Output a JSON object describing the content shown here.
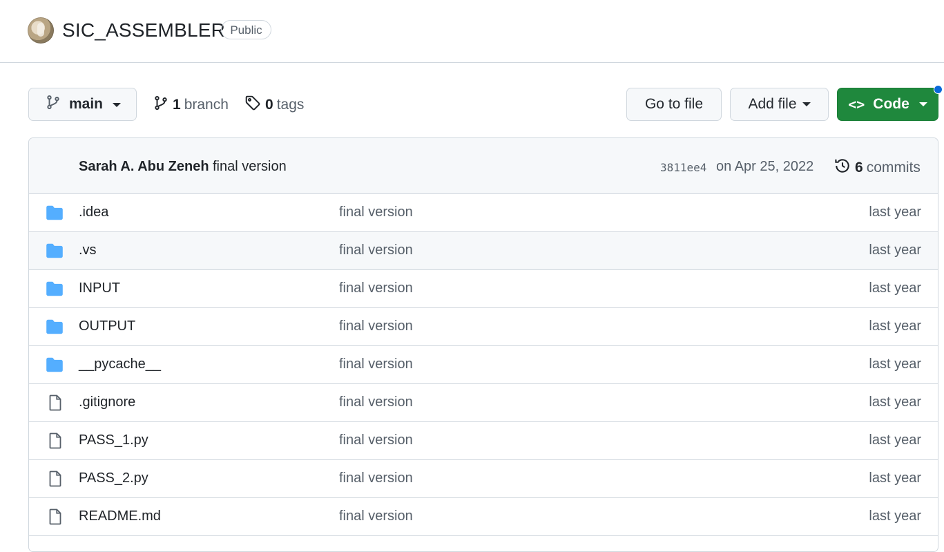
{
  "repo": {
    "name": "SIC_ASSEMBLER",
    "visibility": "Public"
  },
  "toolbar": {
    "branch": "main",
    "branch_count": "1",
    "branch_word": "branch",
    "tag_count": "0",
    "tag_word": "tags",
    "goto_label": "Go to file",
    "addfile_label": "Add file",
    "code_label": "Code"
  },
  "commit": {
    "author": "Sarah A. Abu Zeneh",
    "message": "final version",
    "sha": "3811ee4",
    "date": "on Apr 25, 2022",
    "count": "6",
    "count_word": "commits"
  },
  "files": [
    {
      "type": "dir",
      "icon": "folder-icon",
      "name": ".idea",
      "message": "final version",
      "age": "last year"
    },
    {
      "type": "dir",
      "icon": "folder-icon",
      "name": ".vs",
      "message": "final version",
      "age": "last year"
    },
    {
      "type": "dir",
      "icon": "folder-icon",
      "name": "INPUT",
      "message": "final version",
      "age": "last year"
    },
    {
      "type": "dir",
      "icon": "folder-icon",
      "name": "OUTPUT",
      "message": "final version",
      "age": "last year"
    },
    {
      "type": "dir",
      "icon": "folder-icon",
      "name": "__pycache__",
      "message": "final version",
      "age": "last year"
    },
    {
      "type": "file",
      "icon": "file-icon",
      "name": ".gitignore",
      "message": "final version",
      "age": "last year"
    },
    {
      "type": "file",
      "icon": "file-icon",
      "name": "PASS_1.py",
      "message": "final version",
      "age": "last year"
    },
    {
      "type": "file",
      "icon": "file-icon",
      "name": "PASS_2.py",
      "message": "final version",
      "age": "last year"
    },
    {
      "type": "file",
      "icon": "file-icon",
      "name": "README.md",
      "message": "final version",
      "age": "last year"
    }
  ],
  "colors": {
    "folder": "#54aeff",
    "code_button": "#1f883d",
    "notification": "#0969da"
  }
}
